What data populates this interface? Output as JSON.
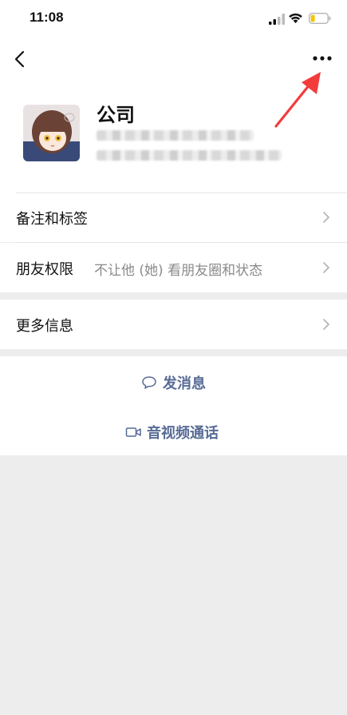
{
  "status_bar": {
    "time": "11:08",
    "icons": [
      "signal-icon",
      "wifi-icon",
      "battery-icon"
    ]
  },
  "nav": {
    "back_icon": "back-chevron-icon",
    "more_icon": "more-dots-icon"
  },
  "profile": {
    "name": "公司"
  },
  "rows": {
    "notes_tags": {
      "label": "备注和标签"
    },
    "permissions": {
      "label": "朋友权限",
      "value": "不让他 (她) 看朋友圈和状态"
    },
    "more_info": {
      "label": "更多信息"
    }
  },
  "actions": {
    "message": {
      "label": "发消息",
      "icon": "chat-bubble-icon"
    },
    "call": {
      "label": "音视频通话",
      "icon": "video-camera-icon"
    }
  },
  "colors": {
    "background": "#ededed",
    "link_blue": "#576b95",
    "annotation_red": "#f23c3c"
  }
}
